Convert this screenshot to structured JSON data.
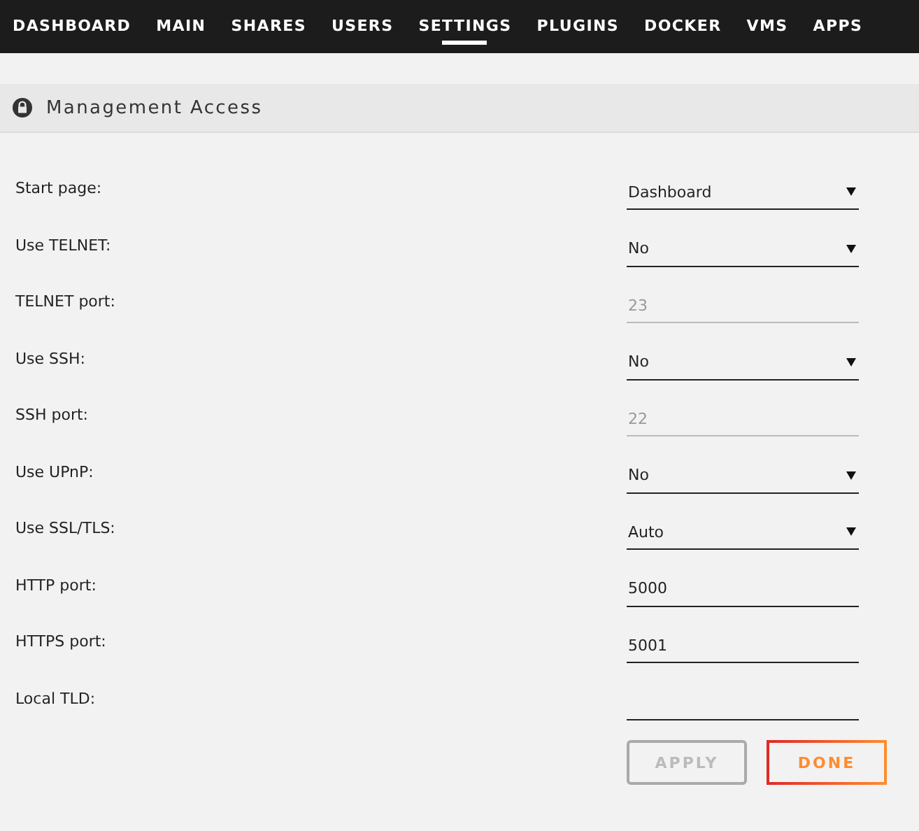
{
  "nav": [
    {
      "label": "DASHBOARD",
      "selected": false
    },
    {
      "label": "MAIN",
      "selected": false
    },
    {
      "label": "SHARES",
      "selected": false
    },
    {
      "label": "USERS",
      "selected": false
    },
    {
      "label": "SETTINGS",
      "selected": true
    },
    {
      "label": "PLUGINS",
      "selected": false
    },
    {
      "label": "DOCKER",
      "selected": false
    },
    {
      "label": "VMS",
      "selected": false
    },
    {
      "label": "APPS",
      "selected": false
    }
  ],
  "section": {
    "title": "Management Access"
  },
  "fields": [
    {
      "label": "Start page:",
      "kind": "select",
      "value": "Dashboard",
      "disabled": false
    },
    {
      "label": "Use TELNET:",
      "kind": "select",
      "value": "No",
      "disabled": false
    },
    {
      "label": "TELNET port:",
      "kind": "input",
      "value": "23",
      "disabled": true
    },
    {
      "label": "Use SSH:",
      "kind": "select",
      "value": "No",
      "disabled": false
    },
    {
      "label": "SSH port:",
      "kind": "input",
      "value": "22",
      "disabled": true
    },
    {
      "label": "Use UPnP:",
      "kind": "select",
      "value": "No",
      "disabled": false
    },
    {
      "label": "Use SSL/TLS:",
      "kind": "select",
      "value": "Auto",
      "disabled": false
    },
    {
      "label": "HTTP port:",
      "kind": "input",
      "value": "5000",
      "disabled": false
    },
    {
      "label": "HTTPS port:",
      "kind": "input",
      "value": "5001",
      "disabled": false
    },
    {
      "label": "Local TLD:",
      "kind": "input",
      "disabled": false
    }
  ],
  "buttons": [
    {
      "label": "APPLY",
      "disabled": true
    },
    {
      "label": "DONE",
      "disabled": false
    }
  ]
}
